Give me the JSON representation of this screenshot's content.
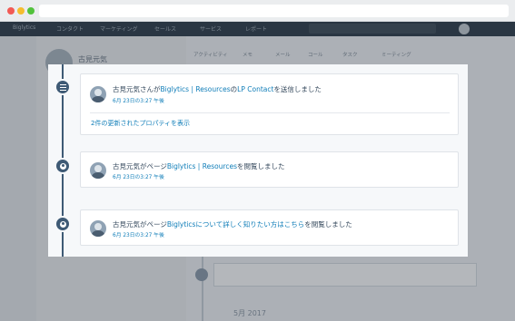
{
  "background_app": {
    "contact_name": "古見元気",
    "nav_items": [
      "Biglytics",
      "コンタクト",
      "マーケティング",
      "セールス",
      "サービス",
      "レポート"
    ],
    "tabs": [
      "アクティビティ",
      "メモ",
      "メール",
      "コール",
      "タスク",
      "ミーティング"
    ],
    "month_label": "5月 2017"
  },
  "timeline": {
    "events": [
      {
        "icon": "form-list-icon",
        "prefix": "古見元気さんが",
        "link1": "Biglytics | Resources",
        "middle": "の",
        "link2": "LP Contact",
        "suffix": "を送信しました",
        "timestamp": "6月 23日の3:27 午後",
        "more_link": "2件の更新されたプロパティを表示"
      },
      {
        "icon": "globe-icon",
        "prefix": "古見元気がページ",
        "link1": "Biglytics | Resources",
        "suffix": "を閲覧しました",
        "timestamp": "6月 23日の3:27 午後"
      },
      {
        "icon": "globe-icon",
        "prefix": "古見元気がページ",
        "link1": "Biglyticsについて詳しく知りたい方はこちら",
        "suffix": "を閲覧しました",
        "timestamp": "6月 23日の3:27 午後"
      }
    ]
  }
}
